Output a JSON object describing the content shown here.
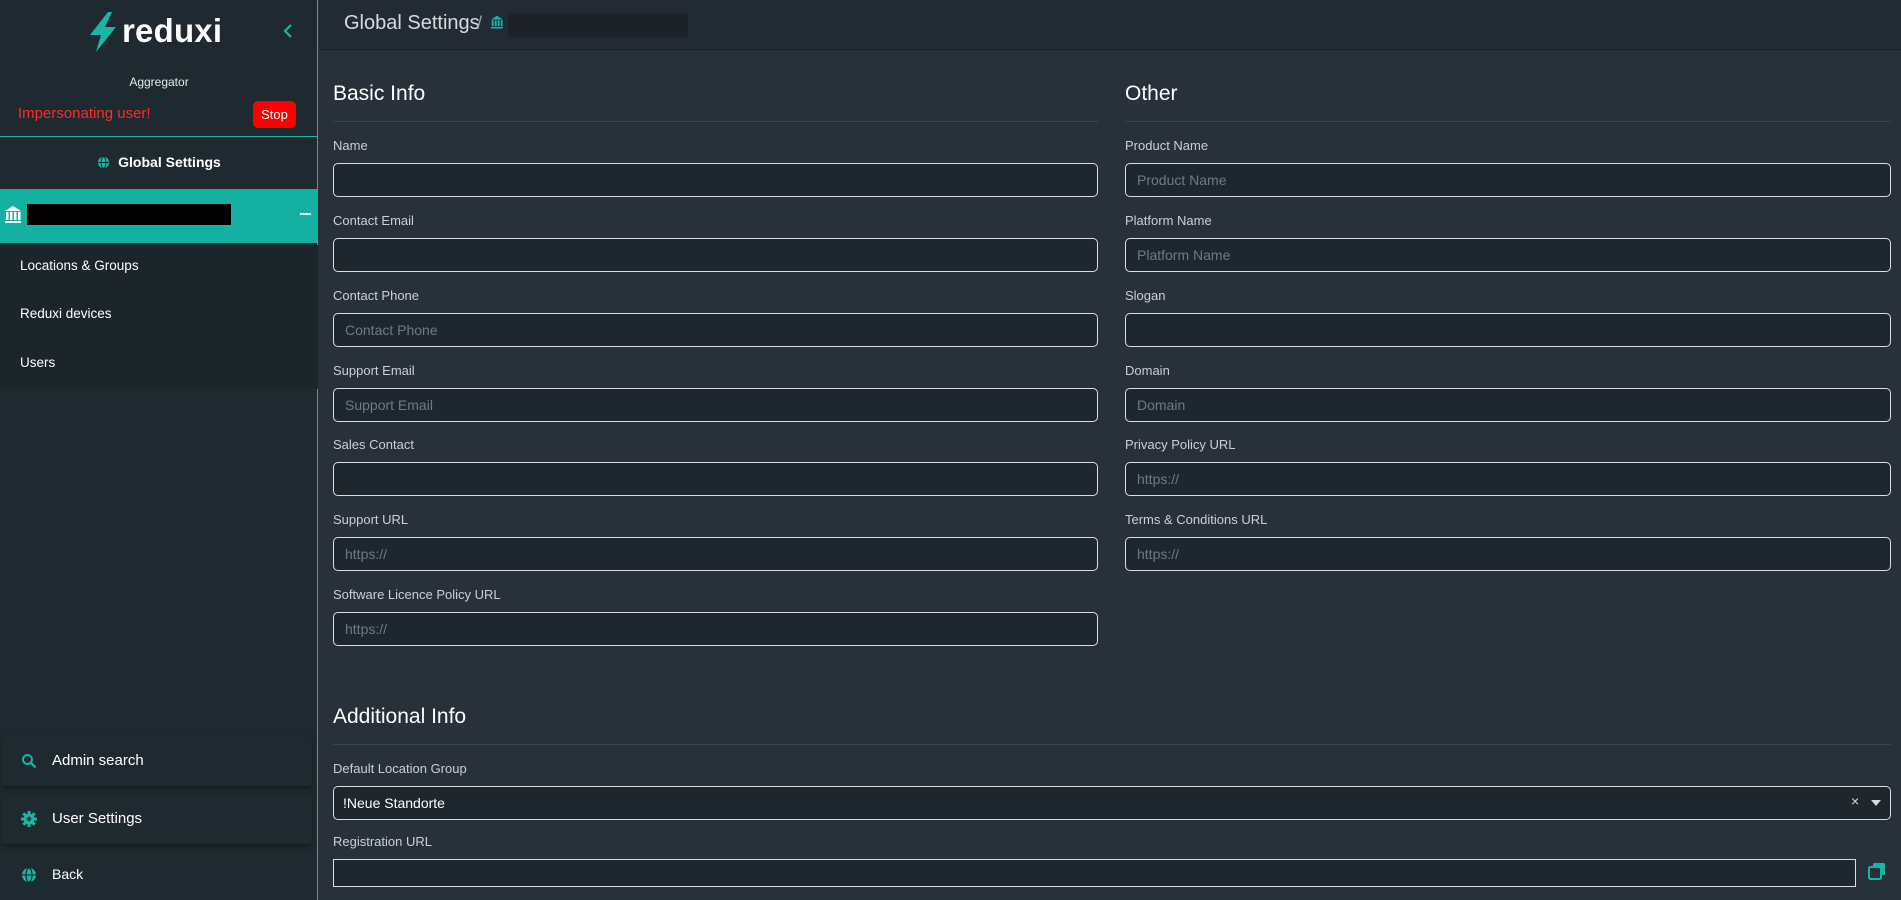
{
  "brand": {
    "name": "reduxi"
  },
  "sidebar": {
    "role": "Aggregator",
    "impersonation_text": "Impersonating user!",
    "stop_label": "Stop",
    "global_settings_label": "Global Settings",
    "menu": [
      {
        "label": "Locations & Groups"
      },
      {
        "label": "Reduxi devices"
      },
      {
        "label": "Users"
      }
    ],
    "bottom": [
      {
        "label": "Admin search",
        "icon": "search-icon"
      },
      {
        "label": "User Settings",
        "icon": "gear-icon"
      },
      {
        "label": "Back",
        "icon": "globe-icon"
      }
    ]
  },
  "breadcrumb": {
    "root": "Global Settings",
    "separator": "/"
  },
  "basic_info": {
    "title": "Basic Info",
    "fields": [
      {
        "label": "Name",
        "value": "",
        "placeholder": ""
      },
      {
        "label": "Contact Email",
        "value": "",
        "placeholder": ""
      },
      {
        "label": "Contact Phone",
        "value": "",
        "placeholder": "Contact Phone"
      },
      {
        "label": "Support Email",
        "value": "",
        "placeholder": "Support Email"
      },
      {
        "label": "Sales Contact",
        "value": "",
        "placeholder": ""
      },
      {
        "label": "Support URL",
        "value": "",
        "placeholder": "https://"
      },
      {
        "label": "Software Licence Policy URL",
        "value": "",
        "placeholder": "https://"
      }
    ]
  },
  "other": {
    "title": "Other",
    "fields": [
      {
        "label": "Product Name",
        "value": "",
        "placeholder": "Product Name"
      },
      {
        "label": "Platform Name",
        "value": "",
        "placeholder": "Platform Name"
      },
      {
        "label": "Slogan",
        "value": "",
        "placeholder": ""
      },
      {
        "label": "Domain",
        "value": "",
        "placeholder": "Domain"
      },
      {
        "label": "Privacy Policy URL",
        "value": "",
        "placeholder": "https://"
      },
      {
        "label": "Terms & Conditions URL",
        "value": "",
        "placeholder": "https://"
      }
    ]
  },
  "additional_info": {
    "title": "Additional Info",
    "default_location_group": {
      "label": "Default Location Group",
      "value": "!Neue Standorte",
      "clear": "×"
    },
    "registration_url": {
      "label": "Registration URL",
      "value": ""
    }
  },
  "colors": {
    "accent": "#14b0a2",
    "danger": "#ff0000",
    "background": "#28313a",
    "sidebar": "#1f2a30"
  }
}
